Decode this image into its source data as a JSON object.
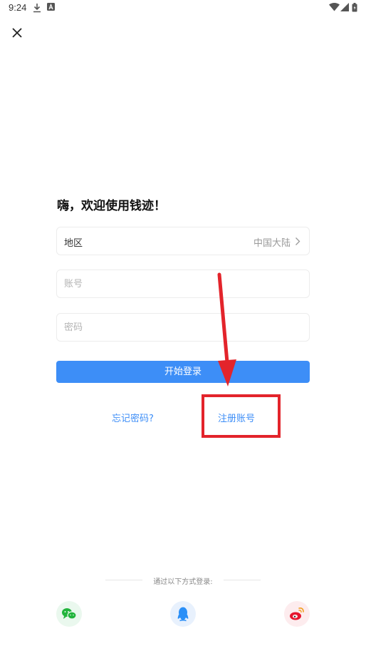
{
  "status_bar": {
    "time": "9:24",
    "icons": [
      "download-icon",
      "a-badge-icon",
      "wifi-icon",
      "signal-icon",
      "battery-icon"
    ]
  },
  "close": {
    "icon": "close-icon"
  },
  "greeting": "嗨，欢迎使用钱迹！",
  "region": {
    "label": "地区",
    "value": "中国大陆"
  },
  "account": {
    "placeholder": "账号",
    "value": ""
  },
  "password": {
    "placeholder": "密码",
    "value": ""
  },
  "login_button": "开始登录",
  "links": {
    "forgot_password": "忘记密码?",
    "register": "注册账号"
  },
  "third_party": {
    "label": "通过以下方式登录:",
    "options": [
      {
        "name": "wechat",
        "icon": "wechat-icon",
        "color": "#22b43c"
      },
      {
        "name": "qq",
        "icon": "qq-icon",
        "color": "#2a8ff7"
      },
      {
        "name": "weibo",
        "icon": "weibo-icon",
        "color": "#e6162d"
      }
    ]
  },
  "colors": {
    "accent": "#3d8ef7",
    "annotation": "#e3242b"
  }
}
